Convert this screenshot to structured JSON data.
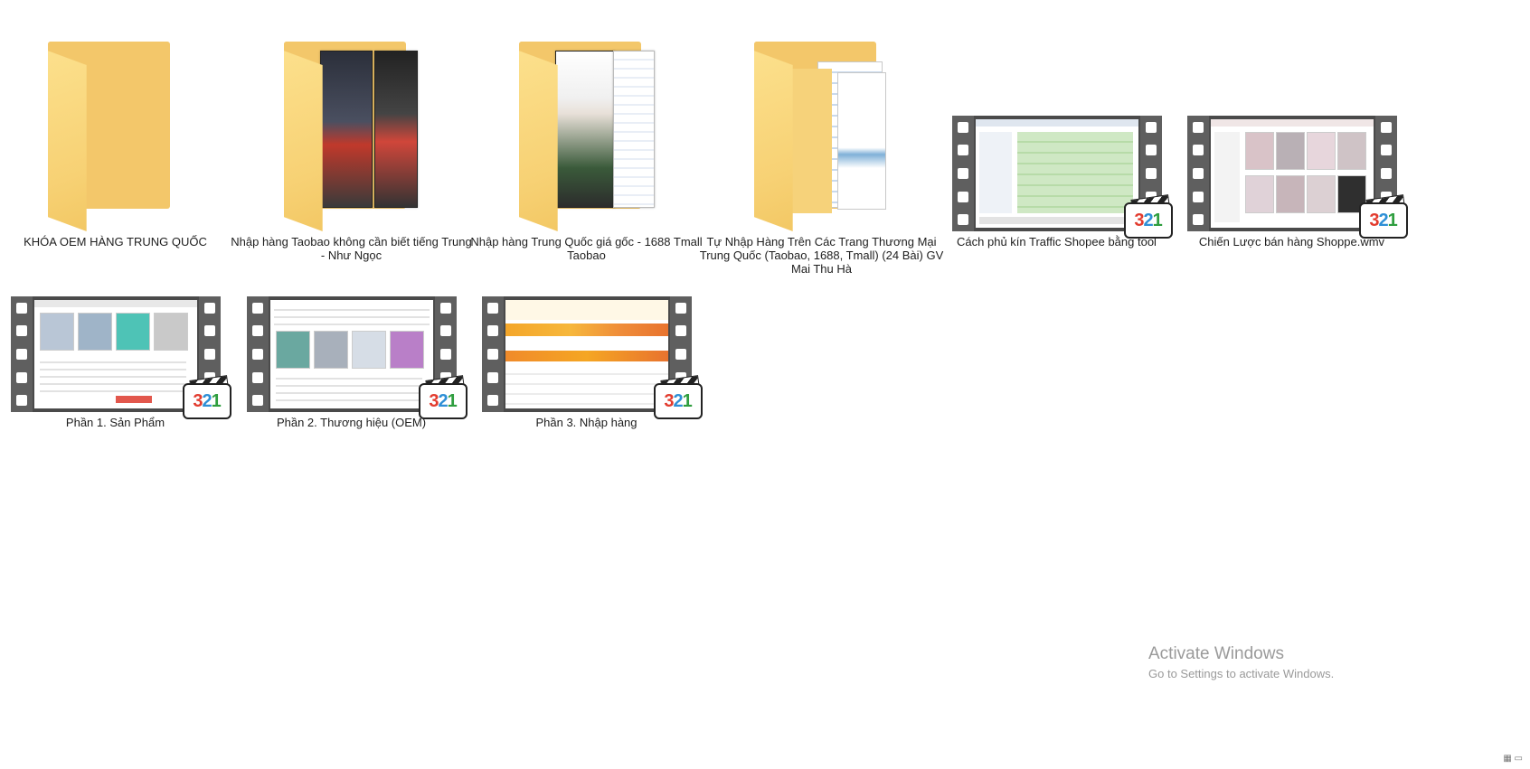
{
  "items": [
    {
      "label": "KHÓA OEM HÀNG TRUNG QUỐC",
      "kind": "folder",
      "icon": "folder-icon"
    },
    {
      "label": "Nhập hàng Taobao không cần biết tiếng Trung - Như Ngọc",
      "kind": "folder",
      "icon": "folder-icon"
    },
    {
      "label": "Nhập hàng Trung Quốc giá gốc - 1688 Tmall Taobao",
      "kind": "folder",
      "icon": "folder-icon"
    },
    {
      "label": "Tự Nhập Hàng Trên Các Trang Thương Mại Trung Quốc (Taobao, 1688, Tmall) (24 Bài) GV Mai Thu Hà",
      "kind": "folder",
      "icon": "folder-icon"
    },
    {
      "label": "Cách phủ kín Traffic Shopee bằng tool",
      "kind": "video",
      "icon": "video-file-icon"
    },
    {
      "label": "Chiến Lược bán hàng Shoppe.wmv",
      "kind": "video",
      "icon": "video-file-icon"
    },
    {
      "label": "Phần 1. Sản Phẩm",
      "kind": "video",
      "icon": "video-file-icon"
    },
    {
      "label": "Phần 2. Thương hiệu (OEM)",
      "kind": "video",
      "icon": "video-file-icon"
    },
    {
      "label": "Phần 3. Nhập hàng",
      "kind": "video",
      "icon": "video-file-icon"
    }
  ],
  "badge": {
    "d1": "3",
    "d2": "2",
    "d3": "1"
  },
  "watermark": {
    "title": "Activate Windows",
    "subtitle": "Go to Settings to activate Windows."
  },
  "colors": {
    "folder": "#f3c76a",
    "background": "#ffffff",
    "text": "#1e1e1e",
    "watermark": "#9a9a9a"
  }
}
